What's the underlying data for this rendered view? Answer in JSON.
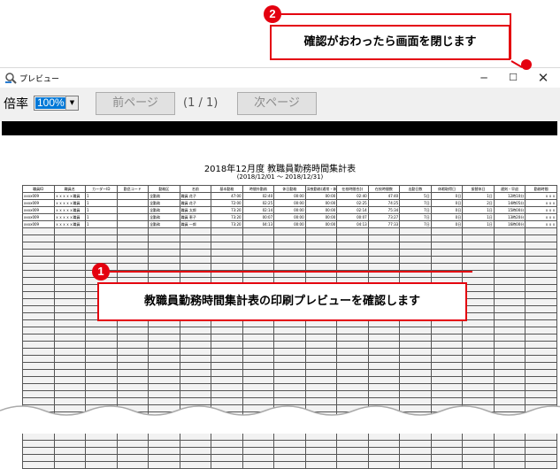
{
  "window": {
    "title": "プレビュー",
    "minimize": "─",
    "maximize": "☐",
    "close": "✕"
  },
  "toolbar": {
    "zoom_label": "倍率",
    "zoom_value": "100%",
    "prev_label": "前ページ",
    "page_indicator": "(1 / 1)",
    "next_label": "次ページ"
  },
  "report": {
    "title": "2018年12月度 教職員勤務時間集計表",
    "period": "(2018/12/01 ～ 2018/12/31)",
    "headers": [
      "職員ID",
      "職員名",
      "カーダーID",
      "勤怠コード",
      "勤務区",
      "名前",
      "基本勤務",
      "時間外勤務",
      "休日勤務",
      "深夜勤務(通常・休日)",
      "在校時間合計",
      "在校時間数",
      "出勤日数",
      "休暇取得日",
      "振替休日",
      "遅刻・早退",
      "勤務時間"
    ],
    "rows": [
      [
        "xxxx009",
        "ｘｘｘｘｘ職員",
        "1",
        "",
        "全勤務",
        "職員 花子",
        "47:00",
        "02:40",
        "00:00",
        "00:00",
        "02:40",
        "47:40",
        "5日",
        "0日",
        "1日",
        "12時10分",
        "ｘｘｘ"
      ],
      [
        "xxxx009",
        "ｘｘｘｘｘ職員",
        "1",
        "",
        "全勤務",
        "職員 花子",
        "72:00",
        "02:25",
        "00:00",
        "00:00",
        "02:25",
        "74:25",
        "7日",
        "0日",
        "2日",
        "14時05分",
        "ｘｘｘ"
      ],
      [
        "xxxx009",
        "ｘｘｘｘｘ職員",
        "1",
        "",
        "全勤務",
        "職員 太郎",
        "73:20",
        "02:14",
        "00:00",
        "00:00",
        "02:14",
        "75:34",
        "7日",
        "0日",
        "1日",
        "15時00分",
        "ｘｘｘ"
      ],
      [
        "xxxx009",
        "ｘｘｘｘｘ職員",
        "1",
        "",
        "全勤務",
        "職員 恵子",
        "73:20",
        "00:07",
        "00:00",
        "00:00",
        "00:07",
        "73:27",
        "7日",
        "0日",
        "1日",
        "13時20分",
        "ｘｘｘ"
      ],
      [
        "xxxx009",
        "ｘｘｘｘｘ職員",
        "1",
        "",
        "全勤務",
        "職員 一郎",
        "73:20",
        "04:13",
        "00:00",
        "00:00",
        "04:13",
        "77:33",
        "7日",
        "0日",
        "1日",
        "16時00分",
        "ｘｘｘ"
      ]
    ]
  },
  "callouts": {
    "one_number": "1",
    "one_text": "教職員勤務時間集計表の印刷プレビューを確認します",
    "two_number": "2",
    "two_text": "確認がおわったら画面を閉じます"
  },
  "colors": {
    "accent": "#e4000f",
    "selection": "#0078d7"
  }
}
